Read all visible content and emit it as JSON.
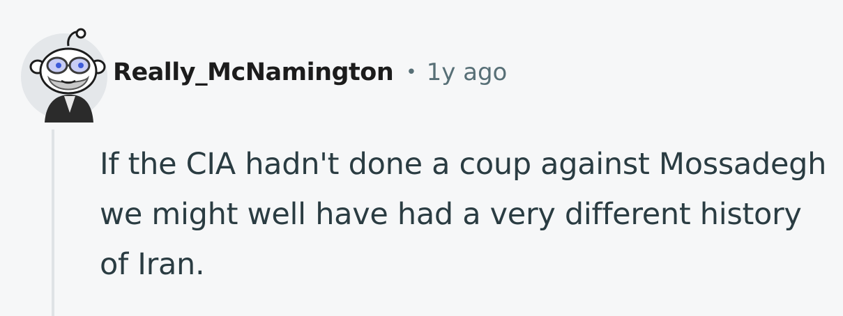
{
  "comment": {
    "author": "Really_McNamington",
    "separator": "•",
    "timestamp": "1y ago",
    "body": "If the CIA hadn't done a coup against Mossadegh we might well have had a very different history of Iran."
  },
  "icons": {
    "avatar": "snoo-avatar-glasses-beard"
  },
  "colors": {
    "background": "#f6f7f8",
    "author": "#1c1c1c",
    "meta": "#576f76",
    "body": "#2a3c42",
    "thread_line": "#dfe3e6"
  }
}
